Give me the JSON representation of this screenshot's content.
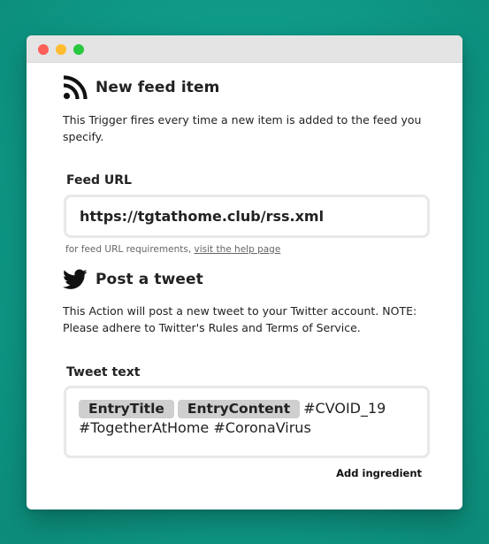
{
  "colors": {
    "background": "#10a08c",
    "close_dot": "#ff5f57",
    "minimize_dot": "#febc2e",
    "zoom_dot": "#28c840",
    "pill_bg": "#cfcfcf"
  },
  "trigger": {
    "icon": "rss-icon",
    "title": "New feed item",
    "description": "This Trigger fires every time a new item is added to the feed you specify.",
    "field_label": "Feed URL",
    "field_value": "https://tgtathome.club/rss.xml",
    "help_prefix": "for feed URL requirements, ",
    "help_link": "visit the help page"
  },
  "action": {
    "icon": "twitter-bird-icon",
    "title": "Post a tweet",
    "description": "This Action will post a new tweet to your Twitter account. NOTE: Please adhere to Twitter's Rules and Terms of Service.",
    "field_label": "Tweet text",
    "ingredients": [
      "EntryTitle",
      "EntryContent"
    ],
    "text_after_ingredients": "#CVOID_19",
    "text_line2": "#TogetherAtHome #CoronaVirus",
    "add_ingredient_label": "Add ingredient"
  }
}
